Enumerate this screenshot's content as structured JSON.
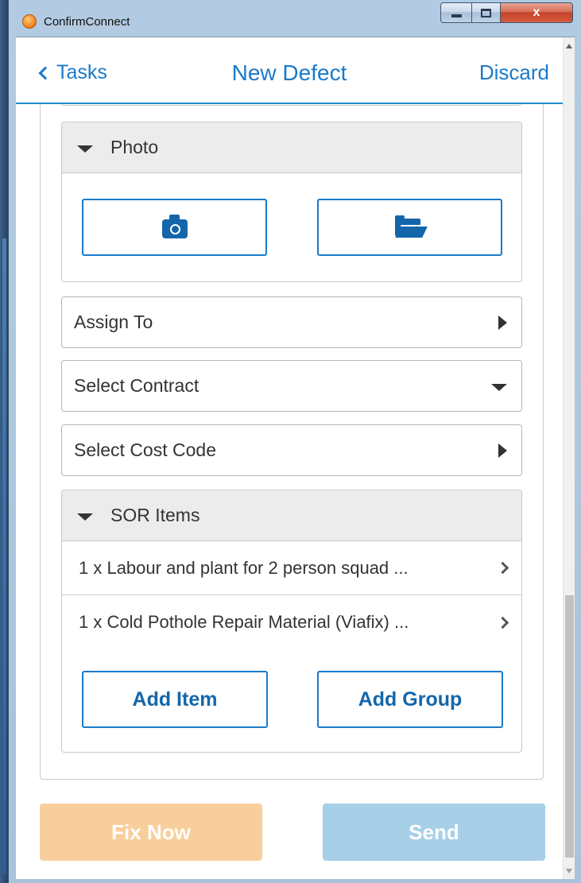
{
  "window": {
    "title": "ConfirmConnect",
    "app_icon": "confirm-app-icon",
    "close_glyph": "x"
  },
  "nav": {
    "back_label": "Tasks",
    "title": "New Defect",
    "discard_label": "Discard"
  },
  "photo": {
    "header": "Photo",
    "camera_icon": "camera-icon",
    "folder_icon": "folder-open-icon"
  },
  "fields": {
    "assign_to": "Assign To",
    "select_contract": "Select Contract",
    "select_cost_code": "Select Cost Code"
  },
  "sor": {
    "header": "SOR Items",
    "items": [
      {
        "label": "1 x Labour and plant for 2 person squad ..."
      },
      {
        "label": "1 x Cold Pothole Repair Material (Viafix) ..."
      }
    ],
    "add_item_label": "Add Item",
    "add_group_label": "Add Group"
  },
  "actions": {
    "fix_now_label": "Fix Now",
    "send_label": "Send"
  },
  "colors": {
    "accent": "#1a7ac9",
    "fix_now_bg": "#f8cf9c",
    "send_bg": "#a8cfe8"
  },
  "scroll": {
    "position_fraction": 0.66
  }
}
